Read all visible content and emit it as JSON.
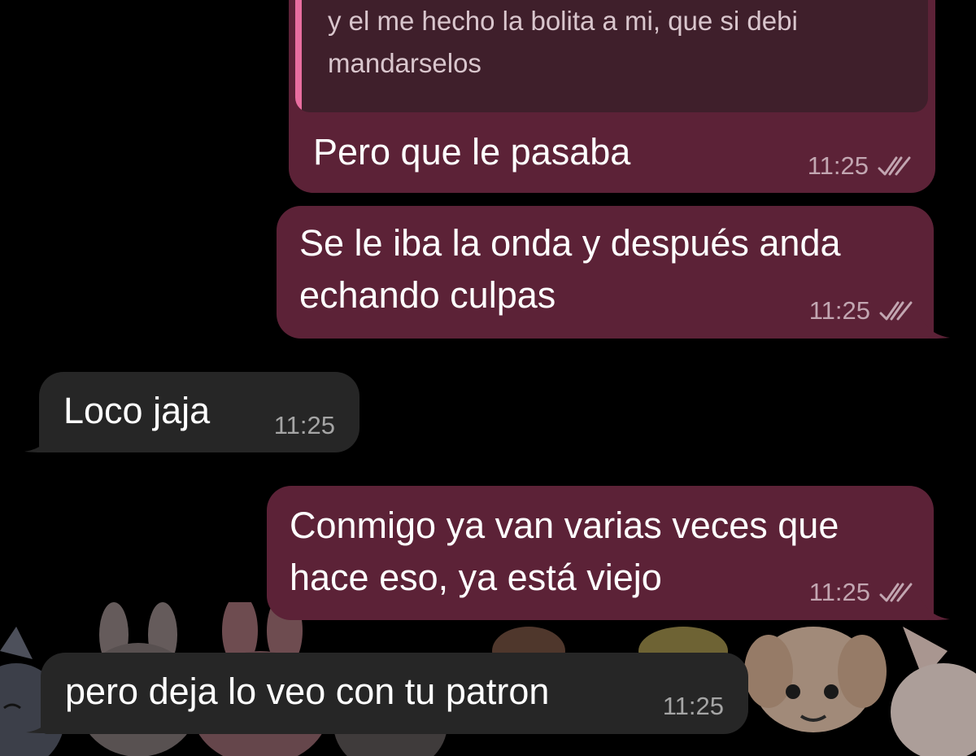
{
  "messages": [
    {
      "direction": "outgoing",
      "quote": {
        "text": "y el me hecho la bolita a mi, que si debi\nmandarselos"
      },
      "text": "Pero que le pasaba",
      "time": "11:25",
      "status_icon": "double-check-icon"
    },
    {
      "direction": "outgoing",
      "text": "Se le iba la onda y después anda\nechando culpas",
      "time": "11:25",
      "status_icon": "double-check-icon"
    },
    {
      "direction": "incoming",
      "text": "Loco jaja",
      "time": "11:25"
    },
    {
      "direction": "outgoing",
      "text": "Conmigo ya van varias veces que\nhace eso, ya está viejo",
      "time": "11:25",
      "status_icon": "double-check-icon"
    },
    {
      "direction": "incoming",
      "text": "pero deja lo veo con tu patron",
      "time": "11:25"
    }
  ],
  "colors": {
    "background": "#000000",
    "outgoing_bubble": "#5c2237",
    "incoming_bubble": "#262626",
    "quote_bar": "#e96ea0"
  }
}
